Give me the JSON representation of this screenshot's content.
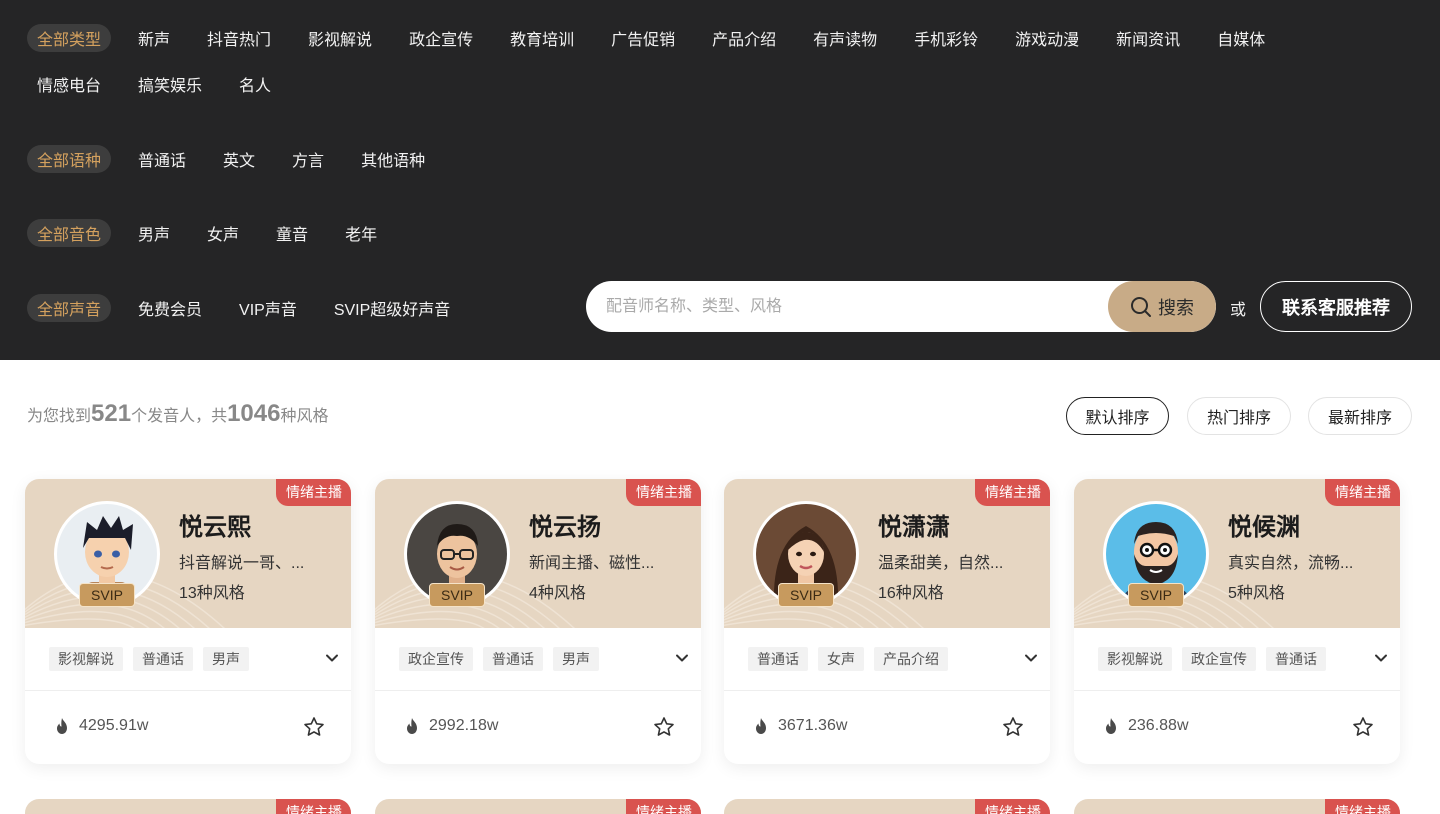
{
  "filters": {
    "type_row1": [
      "全部类型",
      "新声",
      "抖音热门",
      "影视解说",
      "政企宣传",
      "教育培训",
      "广告促销",
      "产品介绍",
      "有声读物",
      "手机彩铃",
      "游戏动漫",
      "新闻资讯",
      "自媒体"
    ],
    "type_row2": [
      "情感电台",
      "搞笑娱乐",
      "名人"
    ],
    "language": [
      "全部语种",
      "普通话",
      "英文",
      "方言",
      "其他语种"
    ],
    "timbre": [
      "全部音色",
      "男声",
      "女声",
      "童音",
      "老年"
    ],
    "voice": [
      "全部声音",
      "免费会员",
      "VIP声音",
      "SVIP超级好声音"
    ]
  },
  "search": {
    "placeholder": "配音师名称、类型、风格",
    "value": "",
    "button_label": "搜索",
    "or_text": "或",
    "contact_label": "联系客服推荐"
  },
  "results": {
    "prefix": "为您找到",
    "speakers": "521",
    "middle": "个发音人，共",
    "styles": "1046",
    "suffix": "种风格"
  },
  "sort": {
    "default": "默认排序",
    "hot": "热门排序",
    "newest": "最新排序"
  },
  "colors": {
    "panel_bg": "#252526",
    "accent_gold": "#d4a15e",
    "card_head_bg": "#e6d6c2",
    "tag_red": "#d9534f",
    "search_btn": "#c8ab87"
  },
  "cards": [
    {
      "tag": "情绪主播",
      "name": "悦云熙",
      "desc": "抖音解说一哥、...",
      "styles": "13种风格",
      "badge": "SVIP",
      "tags": [
        "影视解说",
        "普通话",
        "男声"
      ],
      "plays": "4295.91w",
      "avatar_icon": "cartoon-boy-avatar"
    },
    {
      "tag": "情绪主播",
      "name": "悦云扬",
      "desc": "新闻主播、磁性...",
      "styles": "4种风格",
      "badge": "SVIP",
      "tags": [
        "政企宣传",
        "普通话",
        "男声"
      ],
      "plays": "2992.18w",
      "avatar_icon": "man-glasses-avatar"
    },
    {
      "tag": "情绪主播",
      "name": "悦潇潇",
      "desc": "温柔甜美，自然...",
      "styles": "16种风格",
      "badge": "SVIP",
      "tags": [
        "普通话",
        "女声",
        "产品介绍"
      ],
      "plays": "3671.36w",
      "avatar_icon": "woman-avatar"
    },
    {
      "tag": "情绪主播",
      "name": "悦候渊",
      "desc": "真实自然，流畅...",
      "styles": "5种风格",
      "badge": "SVIP",
      "tags": [
        "影视解说",
        "政企宣传",
        "普通话"
      ],
      "plays": "236.88w",
      "avatar_icon": "bearded-man-avatar"
    }
  ],
  "next_row_tags": [
    "情绪主播",
    "情绪主播",
    "情绪主播",
    "情绪主播"
  ]
}
